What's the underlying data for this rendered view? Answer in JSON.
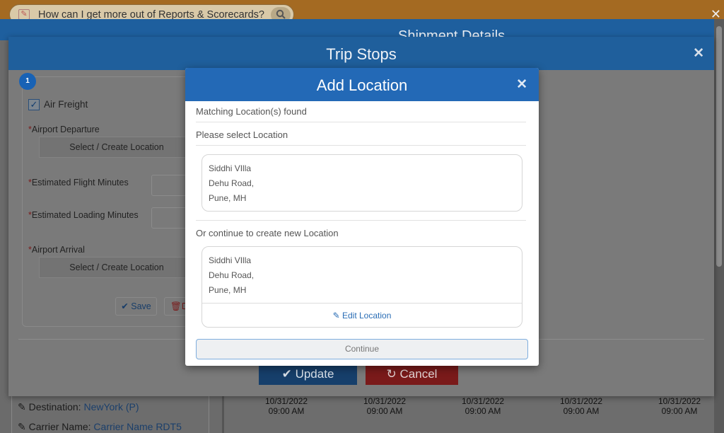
{
  "help_banner": {
    "text": "How can I get more out of Reports & Scorecards?",
    "close_glyph": "✕"
  },
  "shipment": {
    "title": "Shipment Details",
    "destination_label": "Destination: ",
    "destination_value": "NewYork (P)",
    "carrier_label": "Carrier Name: ",
    "carrier_value": "Carrier Name RDT5",
    "timeline": [
      {
        "date": "10/31/2022",
        "time": "09:00 AM"
      },
      {
        "date": "10/31/2022",
        "time": "09:00 AM"
      },
      {
        "date": "10/31/2022",
        "time": "09:00 AM"
      },
      {
        "date": "10/31/2022",
        "time": "09:00 AM"
      },
      {
        "date": "10/31/2022",
        "time": "09:00 AM"
      }
    ]
  },
  "trip_stops": {
    "title": "Trip Stops",
    "close_glyph": "✕",
    "step_number": "1",
    "air_freight_label": "Air Freight",
    "airport_departure_label": "Airport Departure",
    "select_create_label": "Select / Create Location",
    "flight_minutes_label": "Estimated Flight Minutes",
    "loading_minutes_label": "Estimated Loading Minutes",
    "airport_arrival_label": "Airport Arrival",
    "save_label": "Save",
    "delete_label": "D",
    "update_label": "Update",
    "cancel_label": "Cancel",
    "required_mark": "*"
  },
  "add_location": {
    "title": "Add Location",
    "close_glyph": "✕",
    "matching_text": "Matching Location(s) found",
    "select_prompt": "Please select Location",
    "matching_location": {
      "line1": "Siddhi VIlla",
      "line2": "Dehu Road,",
      "line3": "Pune, MH"
    },
    "or_continue_text": "Or continue to create new Location",
    "new_location": {
      "line1": "Siddhi VIlla",
      "line2": "Dehu Road,",
      "line3": "Pune, MH"
    },
    "edit_location_label": "Edit Location",
    "continue_label": "Continue"
  },
  "colors": {
    "primary_blue": "#2369b6",
    "update_blue": "#1f64b0",
    "cancel_red": "#d42626",
    "banner_orange": "#d4892c"
  }
}
